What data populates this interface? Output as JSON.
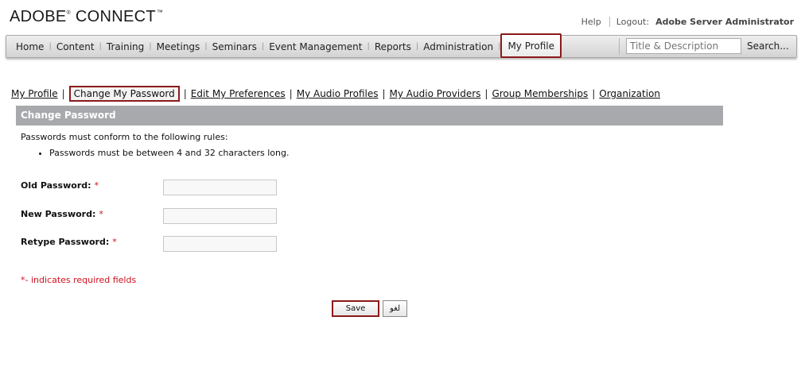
{
  "brand": {
    "name": "ADOBE",
    "reg": "®",
    "product": " CONNECT",
    "tm": "™"
  },
  "top_links": {
    "help": "Help",
    "logout_label": "Logout:",
    "user": "Adobe Server Administrator"
  },
  "nav": {
    "items": [
      "Home",
      "Content",
      "Training",
      "Meetings",
      "Seminars",
      "Event Management",
      "Reports",
      "Administration",
      "My Profile"
    ],
    "active": "My Profile",
    "search_placeholder": "Title & Description",
    "search_button": "Search..."
  },
  "subnav": {
    "items": [
      "My Profile",
      "Change My Password",
      "Edit My Preferences",
      "My Audio Profiles",
      "My Audio Providers",
      "Group Memberships",
      "Organization"
    ],
    "active": "Change My Password"
  },
  "section": {
    "title": "Change Password",
    "rules_intro": "Passwords must conform to the following rules:",
    "rules": [
      "Passwords must be between 4 and 32 characters long."
    ]
  },
  "form": {
    "old_password_label": "Old Password:",
    "new_password_label": "New Password:",
    "retype_password_label": "Retype Password:",
    "required_mark": "*",
    "old_password_value": "",
    "new_password_value": "",
    "retype_password_value": "",
    "required_note": "*- indicates required fields",
    "save_label": "Save",
    "cancel_label": "لغو"
  },
  "colors": {
    "accent_border": "#8b1a1a",
    "section_bar": "#a7a9ac",
    "required": "#d1111d"
  }
}
